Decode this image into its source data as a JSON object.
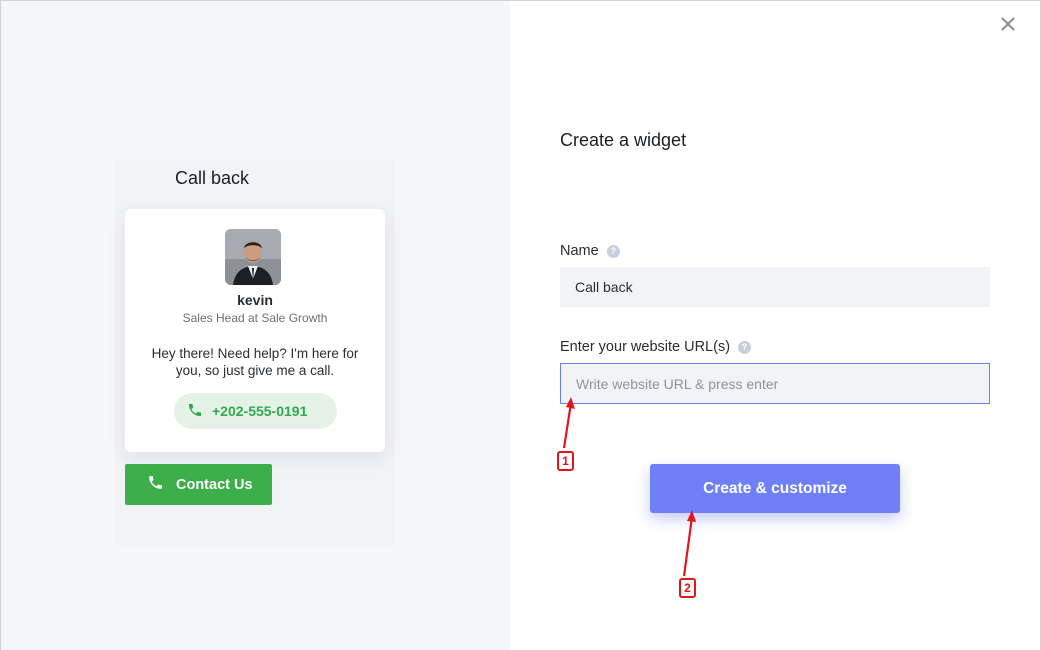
{
  "preview": {
    "title": "Call back",
    "agent_name": "kevin",
    "agent_role": "Sales Head at Sale Growth",
    "greeting": "Hey there! Need help? I'm here for you, so just give me a call.",
    "phone": "+202-555-0191",
    "contact_button": "Contact Us"
  },
  "form": {
    "title": "Create a widget",
    "name_label": "Name",
    "name_value": "Call back",
    "url_label": "Enter your website URL(s)",
    "url_placeholder": "Write website URL & press enter",
    "submit_label": "Create & customize"
  },
  "annotations": [
    {
      "label": "1"
    },
    {
      "label": "2"
    }
  ],
  "icons": {
    "close": "close-icon",
    "phone": "phone-icon",
    "help": "help-icon"
  },
  "colors": {
    "accent": "#6e7ff8",
    "contact_green": "#3daf4a",
    "phone_green": "#2fa84f",
    "annotation_red": "#e0161b"
  }
}
